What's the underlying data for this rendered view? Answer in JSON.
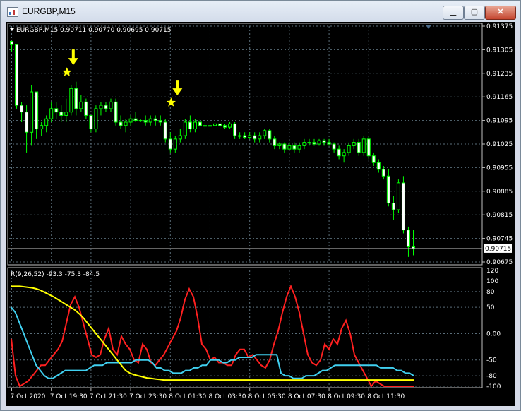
{
  "window": {
    "title": "EURGBP,M15",
    "minimize_glyph": "▁",
    "maximize_glyph": "▢",
    "close_glyph": "✕"
  },
  "main_panel": {
    "info_label": "EURGBP,M15  0.90711 0.90770 0.90695 0.90715",
    "current_price": "0.90715",
    "price_ticks": [
      "0.91375",
      "0.91305",
      "0.91235",
      "0.91165",
      "0.91095",
      "0.91025",
      "0.90955",
      "0.90885",
      "0.90815",
      "0.90745",
      "0.90675"
    ],
    "arrow_color": "#ffff00"
  },
  "indicator_panel": {
    "label": "R(9,26,52) -93.3 -75.3 -84.5",
    "ticks": [
      "120",
      "100",
      "80",
      "50",
      "0.00",
      "-50",
      "-80",
      "-100"
    ]
  },
  "time_axis": {
    "labels": [
      "7 Oct 2020",
      "7 Oct 19:30",
      "7 Oct 21:30",
      "7 Oct 23:30",
      "8 Oct 01:30",
      "8 Oct 03:30",
      "8 Oct 05:30",
      "8 Oct 07:30",
      "8 Oct 09:30",
      "8 Oct 11:30"
    ]
  },
  "colors": {
    "background": "#000000",
    "candle": "#00ff00",
    "grid": "#5a6e7a",
    "fast_line": "#ff2020",
    "mid_line": "#40d0f0",
    "slow_line": "#ffff00"
  },
  "chart_data": [
    {
      "type": "candlestick",
      "symbol": "EURGBP",
      "timeframe": "M15",
      "ylim": [
        0.90675,
        0.91375
      ],
      "candles": [
        [
          0.9133,
          0.9133,
          0.913,
          0.9132
        ],
        [
          0.9132,
          0.9132,
          0.9113,
          0.9114
        ],
        [
          0.9114,
          0.9115,
          0.9109,
          0.9112
        ],
        [
          0.9112,
          0.9114,
          0.91,
          0.9106
        ],
        [
          0.9106,
          0.912,
          0.9102,
          0.9118
        ],
        [
          0.9118,
          0.9118,
          0.9104,
          0.9107
        ],
        [
          0.9107,
          0.9109,
          0.9105,
          0.9108
        ],
        [
          0.9108,
          0.9111,
          0.9106,
          0.911
        ],
        [
          0.911,
          0.9115,
          0.9109,
          0.9113
        ],
        [
          0.9113,
          0.9115,
          0.911,
          0.9112
        ],
        [
          0.9112,
          0.9114,
          0.9109,
          0.9111
        ],
        [
          0.9111,
          0.9116,
          0.9109,
          0.9112
        ],
        [
          0.9112,
          0.912,
          0.9111,
          0.9119
        ],
        [
          0.9119,
          0.9121,
          0.9111,
          0.9113
        ],
        [
          0.9113,
          0.9117,
          0.9112,
          0.9115
        ],
        [
          0.9115,
          0.9116,
          0.911,
          0.9111
        ],
        [
          0.9111,
          0.9111,
          0.9106,
          0.9107
        ],
        [
          0.9107,
          0.9114,
          0.9106,
          0.9113
        ],
        [
          0.9113,
          0.9115,
          0.9111,
          0.9114
        ],
        [
          0.9114,
          0.9115,
          0.9112,
          0.9113
        ],
        [
          0.9113,
          0.9116,
          0.9112,
          0.9115
        ],
        [
          0.9115,
          0.9116,
          0.9108,
          0.9109
        ],
        [
          0.9109,
          0.9111,
          0.9107,
          0.9108
        ],
        [
          0.9108,
          0.911,
          0.9106,
          0.9109
        ],
        [
          0.9109,
          0.9111,
          0.9108,
          0.911
        ],
        [
          0.911,
          0.9112,
          0.9109,
          0.91095
        ],
        [
          0.91095,
          0.911,
          0.9109,
          0.91095
        ],
        [
          0.91095,
          0.9111,
          0.9108,
          0.9109
        ],
        [
          0.9109,
          0.9111,
          0.9108,
          0.911
        ],
        [
          0.911,
          0.9111,
          0.9108,
          0.91095
        ],
        [
          0.91095,
          0.9111,
          0.9108,
          0.9109
        ],
        [
          0.9109,
          0.911,
          0.9103,
          0.9104
        ],
        [
          0.9104,
          0.9106,
          0.91,
          0.9101
        ],
        [
          0.9101,
          0.9105,
          0.91,
          0.9104
        ],
        [
          0.9104,
          0.9107,
          0.9103,
          0.9105
        ],
        [
          0.9105,
          0.911,
          0.9104,
          0.9109
        ],
        [
          0.9109,
          0.9111,
          0.9106,
          0.9107
        ],
        [
          0.9107,
          0.911,
          0.9106,
          0.9109
        ],
        [
          0.9109,
          0.911,
          0.9107,
          0.9108
        ],
        [
          0.9108,
          0.9109,
          0.9107,
          0.9108
        ],
        [
          0.9108,
          0.9109,
          0.9107,
          0.9108
        ],
        [
          0.9108,
          0.9109,
          0.9107,
          0.91085
        ],
        [
          0.91085,
          0.9109,
          0.9107,
          0.9108
        ],
        [
          0.9108,
          0.91085,
          0.9107,
          0.91075
        ],
        [
          0.91075,
          0.9109,
          0.9107,
          0.91085
        ],
        [
          0.91085,
          0.9109,
          0.9104,
          0.9105
        ],
        [
          0.9105,
          0.9106,
          0.9104,
          0.9105
        ],
        [
          0.9105,
          0.9106,
          0.9104,
          0.91045
        ],
        [
          0.91045,
          0.9106,
          0.9104,
          0.9105
        ],
        [
          0.9105,
          0.9106,
          0.9103,
          0.9104
        ],
        [
          0.9104,
          0.9106,
          0.9103,
          0.9105
        ],
        [
          0.9105,
          0.9107,
          0.9104,
          0.91065
        ],
        [
          0.91065,
          0.9107,
          0.9103,
          0.9104
        ],
        [
          0.9104,
          0.9105,
          0.9101,
          0.9102
        ],
        [
          0.9102,
          0.9103,
          0.9101,
          0.91025
        ],
        [
          0.91025,
          0.9103,
          0.91,
          0.9101
        ],
        [
          0.9101,
          0.9103,
          0.9101,
          0.9102
        ],
        [
          0.9102,
          0.9103,
          0.91,
          0.9101
        ],
        [
          0.9101,
          0.9103,
          0.91,
          0.9102
        ],
        [
          0.9102,
          0.9104,
          0.9101,
          0.9103
        ],
        [
          0.9103,
          0.9104,
          0.9102,
          0.9103
        ],
        [
          0.9103,
          0.9104,
          0.9102,
          0.91025
        ],
        [
          0.91025,
          0.9104,
          0.9102,
          0.91035
        ],
        [
          0.91035,
          0.9104,
          0.9102,
          0.9103
        ],
        [
          0.9103,
          0.9104,
          0.9102,
          0.91025
        ],
        [
          0.91025,
          0.9103,
          0.91,
          0.9101
        ],
        [
          0.9101,
          0.9102,
          0.9098,
          0.9099
        ],
        [
          0.9099,
          0.9101,
          0.9097,
          0.91
        ],
        [
          0.91,
          0.9103,
          0.9099,
          0.9102
        ],
        [
          0.9102,
          0.9104,
          0.9101,
          0.9103
        ],
        [
          0.9103,
          0.9104,
          0.9099,
          0.91
        ],
        [
          0.91,
          0.9105,
          0.9099,
          0.9104
        ],
        [
          0.9104,
          0.9105,
          0.9098,
          0.9099
        ],
        [
          0.9099,
          0.91,
          0.9096,
          0.9097
        ],
        [
          0.9097,
          0.9098,
          0.9094,
          0.9095
        ],
        [
          0.9095,
          0.9096,
          0.9092,
          0.9093
        ],
        [
          0.9093,
          0.9095,
          0.9084,
          0.9085
        ],
        [
          0.9085,
          0.9087,
          0.908,
          0.9083
        ],
        [
          0.9083,
          0.9092,
          0.9082,
          0.9091
        ],
        [
          0.9091,
          0.9093,
          0.9076,
          0.9077
        ],
        [
          0.9077,
          0.9078,
          0.9069,
          0.9072
        ],
        [
          0.9072,
          0.9077,
          0.90695,
          0.90715
        ]
      ],
      "markers": [
        {
          "candle": 12,
          "price": 0.9123
        },
        {
          "candle": 33,
          "price": 0.9114
        }
      ]
    },
    {
      "type": "line",
      "name": "R(9,26,52)",
      "ylim": [
        -100,
        120
      ],
      "series": [
        {
          "values": [
            -10,
            -80,
            -100,
            -95,
            -90,
            -80,
            -70,
            -60,
            -60,
            -50,
            -40,
            -30,
            -15,
            20,
            55,
            70,
            50,
            20,
            -10,
            -40,
            -45,
            -40,
            -10,
            10,
            -30,
            -40,
            -5,
            -20,
            -30,
            -50,
            -55,
            -20,
            -30,
            -55,
            -60,
            -50,
            -40,
            -25,
            -10,
            5,
            30,
            65,
            85,
            70,
            30,
            -20,
            -30,
            -50,
            -45,
            -55,
            -55,
            -60,
            -60,
            -40,
            -30,
            -30,
            -45,
            -40,
            -50,
            -60,
            -65,
            -50,
            -20,
            5,
            40,
            70,
            90,
            70,
            40,
            0,
            -40,
            -55,
            -60,
            -50,
            -20,
            -30,
            -10,
            -20,
            10,
            25,
            0,
            -40,
            -55,
            -70,
            -85,
            -100,
            -90,
            -95,
            -100,
            -100,
            -100,
            -100,
            -100,
            -100,
            -100,
            -100
          ]
        },
        {
          "values": [
            50,
            40,
            20,
            0,
            -20,
            -40,
            -60,
            -70,
            -80,
            -85,
            -85,
            -80,
            -75,
            -70,
            -70,
            -70,
            -70,
            -70,
            -70,
            -65,
            -60,
            -60,
            -60,
            -55,
            -55,
            -55,
            -55,
            -55,
            -55,
            -55,
            -50,
            -50,
            -50,
            -50,
            -55,
            -65,
            -65,
            -70,
            -70,
            -75,
            -75,
            -75,
            -70,
            -70,
            -65,
            -65,
            -60,
            -60,
            -50,
            -50,
            -50,
            -55,
            -55,
            -50,
            -50,
            -45,
            -45,
            -45,
            -45,
            -40,
            -40,
            -40,
            -40,
            -40,
            -40,
            -75,
            -80,
            -80,
            -85,
            -85,
            -85,
            -80,
            -80,
            -80,
            -75,
            -70,
            -70,
            -65,
            -60,
            -60,
            -60,
            -60,
            -60,
            -60,
            -60,
            -60,
            -60,
            -60,
            -60,
            -65,
            -65,
            -65,
            -65,
            -70,
            -70,
            -75,
            -75,
            -80
          ]
        },
        {
          "values": [
            90,
            90,
            90,
            89,
            88,
            87,
            85,
            82,
            78,
            74,
            70,
            65,
            60,
            55,
            50,
            45,
            38,
            30,
            20,
            10,
            0,
            -10,
            -20,
            -30,
            -40,
            -50,
            -60,
            -70,
            -75,
            -78,
            -80,
            -82,
            -84,
            -85,
            -86,
            -87,
            -88,
            -88,
            -88,
            -88,
            -88,
            -88,
            -88,
            -88,
            -88,
            -88,
            -88,
            -88,
            -88,
            -88,
            -88,
            -88,
            -88,
            -88,
            -88,
            -88,
            -88,
            -88,
            -88,
            -88,
            -88,
            -88,
            -88,
            -88,
            -88,
            -88,
            -88,
            -88,
            -88,
            -88,
            -88,
            -88,
            -88,
            -88,
            -88,
            -88,
            -88,
            -88,
            -88,
            -88,
            -88,
            -88,
            -88,
            -88,
            -88,
            -88,
            -88,
            -88,
            -88,
            -88,
            -88,
            -88,
            -88,
            -88,
            -88,
            -88
          ]
        }
      ]
    }
  ]
}
